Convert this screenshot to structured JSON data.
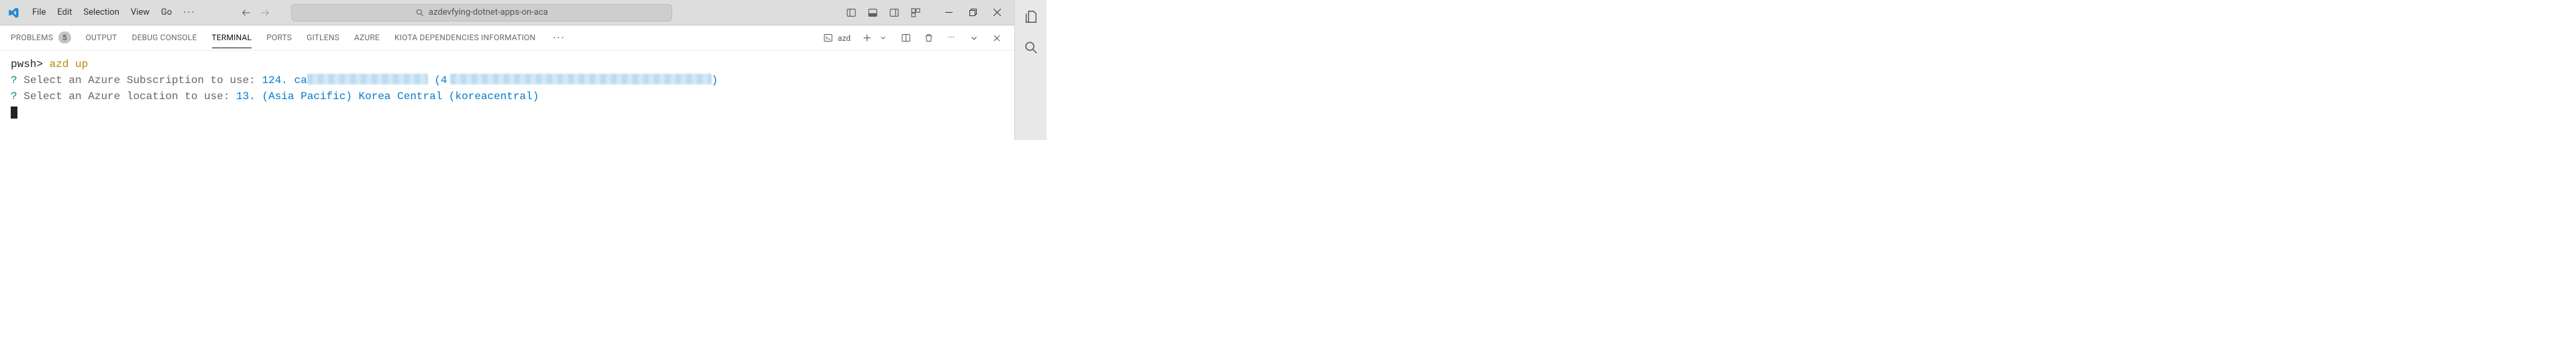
{
  "menu": {
    "items": [
      "File",
      "Edit",
      "Selection",
      "View",
      "Go"
    ],
    "overflow": "···"
  },
  "search": {
    "placeholder": "azdevfying-dotnet-apps-on-aca"
  },
  "panel": {
    "tabs": [
      {
        "label": "PROBLEMS",
        "badge": "5"
      },
      {
        "label": "OUTPUT"
      },
      {
        "label": "DEBUG CONSOLE"
      },
      {
        "label": "TERMINAL",
        "active": true
      },
      {
        "label": "PORTS"
      },
      {
        "label": "GITLENS"
      },
      {
        "label": "AZURE"
      },
      {
        "label": "KIOTA DEPENDENCIES INFORMATION"
      }
    ],
    "overflow": "···",
    "actions": {
      "shell_label": "azd",
      "more": "···"
    }
  },
  "terminal": {
    "prompt": "pwsh>",
    "command": "azd up",
    "line1": {
      "q": "?",
      "text": "Select an Azure Subscription to use:",
      "answer_prefix": "124. ca",
      "paren_open": "(4",
      "paren_close": ")"
    },
    "line2": {
      "q": "?",
      "text": "Select an Azure location to use:",
      "answer": "13. (Asia Pacific) Korea Central (koreacentral)"
    }
  }
}
